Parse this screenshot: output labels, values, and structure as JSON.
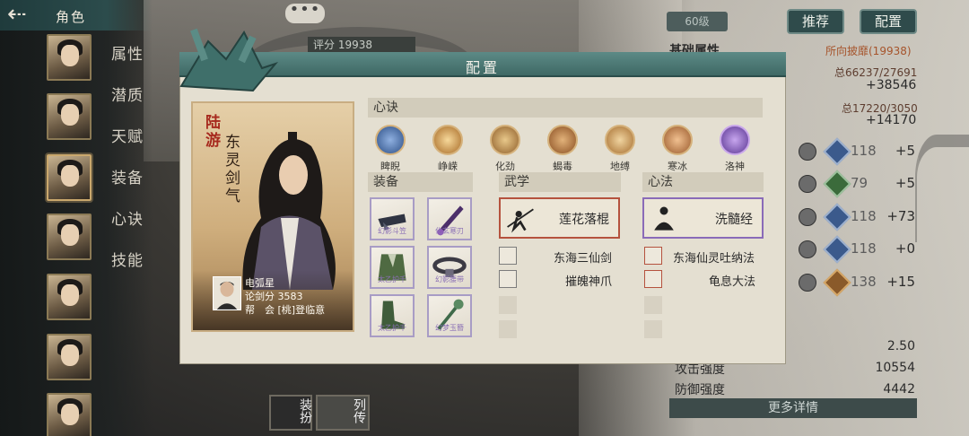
{
  "header": {
    "title": "角色"
  },
  "sidebar": {
    "tabs": [
      "属性",
      "潜质",
      "天赋",
      "装备",
      "心诀",
      "技能"
    ]
  },
  "chat": {
    "icon": "chat-bubble-icon",
    "dots": "•••"
  },
  "score": {
    "label": "评分 19938"
  },
  "right_panel": {
    "level": "60级",
    "recommend_button": "推荐",
    "config_button": "配置",
    "basic_title": "基础属性",
    "recommended_text": "所向披靡(19938)",
    "total1_small": "总66237/27691",
    "total1_big": "+38546",
    "total2_small": "总17220/3050",
    "total2_big": "+14170",
    "stats": [
      {
        "icon_label": "剑法",
        "value": "118",
        "add": "+5"
      },
      {
        "icon_label": "奇门",
        "value": "79",
        "add": "+5"
      },
      {
        "icon_label": "拳法",
        "value": "118",
        "add": "+73"
      },
      {
        "icon_label": "轻功",
        "value": "118",
        "add": "+0"
      },
      {
        "icon_label": "定力",
        "value": "138",
        "add": "+15"
      }
    ],
    "value_2_50": "2.50",
    "attack_label": "攻击强度",
    "attack_value": "10554",
    "defense_label": "防御强度",
    "defense_value": "4442",
    "more_button": "更多详情"
  },
  "bottom": {
    "equip_text": "装扮",
    "bio_text": "列传"
  },
  "modal": {
    "title": "配置",
    "character": {
      "name": "陆游",
      "sect": "东灵剑气",
      "nickname": "电弧星",
      "sword_score_label": "论剑分",
      "sword_score": "3583",
      "guild_label": "帮",
      "guild_label2": "会",
      "guild_name": "[桃]登临意"
    },
    "xinjue": {
      "title": "心诀",
      "items": [
        {
          "name": "睥睨",
          "color": "#4a78b8"
        },
        {
          "name": "峥嵘",
          "color": "#c9842f"
        },
        {
          "name": "化劲",
          "color": "#b07a3a"
        },
        {
          "name": "蝎毒",
          "color": "#a6602e"
        },
        {
          "name": "地缚",
          "color": "#c48a3a"
        },
        {
          "name": "寒冰",
          "color": "#b06838"
        },
        {
          "name": "洛神",
          "color": "#7a4fb5"
        }
      ]
    },
    "equipment": {
      "title": "装备",
      "items": [
        "幻影斗笠",
        "化玄寒刃",
        "太乙护千",
        "幻影腰带",
        "太乙护千",
        "幻梦玉簪"
      ]
    },
    "wuxue": {
      "title": "武学",
      "main": "莲花落棍",
      "subs": [
        "东海三仙剑",
        "摧魄神爪"
      ]
    },
    "xinfa": {
      "title": "心法",
      "main": "洗髓经",
      "subs": [
        "东海仙灵吐纳法",
        "龟息大法"
      ]
    }
  }
}
